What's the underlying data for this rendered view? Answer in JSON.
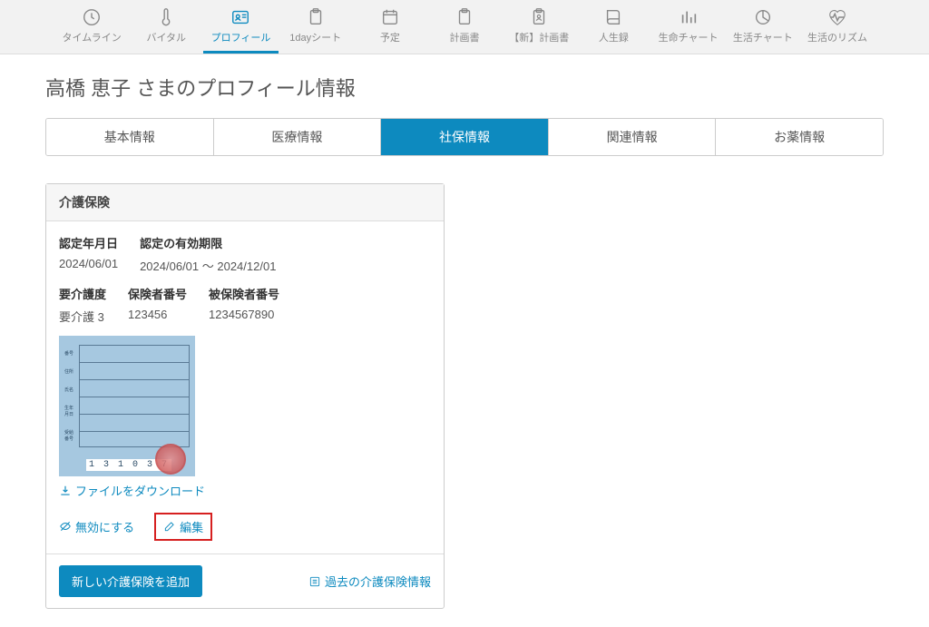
{
  "topnav": [
    {
      "label": "タイムライン",
      "icon": "clock"
    },
    {
      "label": "バイタル",
      "icon": "thermometer"
    },
    {
      "label": "プロフィール",
      "icon": "idcard",
      "active": true
    },
    {
      "label": "1dayシート",
      "icon": "clipboard"
    },
    {
      "label": "予定",
      "icon": "calendar"
    },
    {
      "label": "計画書",
      "icon": "clipboard"
    },
    {
      "label": "【新】計画書",
      "icon": "clipboard-user"
    },
    {
      "label": "人生録",
      "icon": "book"
    },
    {
      "label": "生命チャート",
      "icon": "barchart"
    },
    {
      "label": "生活チャート",
      "icon": "piechart"
    },
    {
      "label": "生活のリズム",
      "icon": "heartbeat"
    }
  ],
  "page_title": "高橋 恵子 さまのプロフィール情報",
  "tabs": [
    {
      "label": "基本情報"
    },
    {
      "label": "医療情報"
    },
    {
      "label": "社保情報",
      "active": true
    },
    {
      "label": "関連情報"
    },
    {
      "label": "お薬情報"
    }
  ],
  "card": {
    "title": "介護保険",
    "fields": {
      "cert_date": {
        "label": "認定年月日",
        "value": "2024/06/01"
      },
      "cert_period": {
        "label": "認定の有効期限",
        "value": "2024/06/01  ～  2024/12/01"
      },
      "care_level": {
        "label": "要介護度",
        "value": "要介護 3"
      },
      "insurer_no": {
        "label": "保険者番号",
        "value": "123456"
      },
      "insured_no": {
        "label": "被保険者番号",
        "value": "1234567890"
      }
    },
    "thumb_code": "1 3 1 0 3 7",
    "download_label": "ファイルをダウンロード",
    "disable_label": "無効にする",
    "edit_label": "編集",
    "add_button": "新しい介護保険を追加",
    "history_link": "過去の介護保険情報"
  }
}
